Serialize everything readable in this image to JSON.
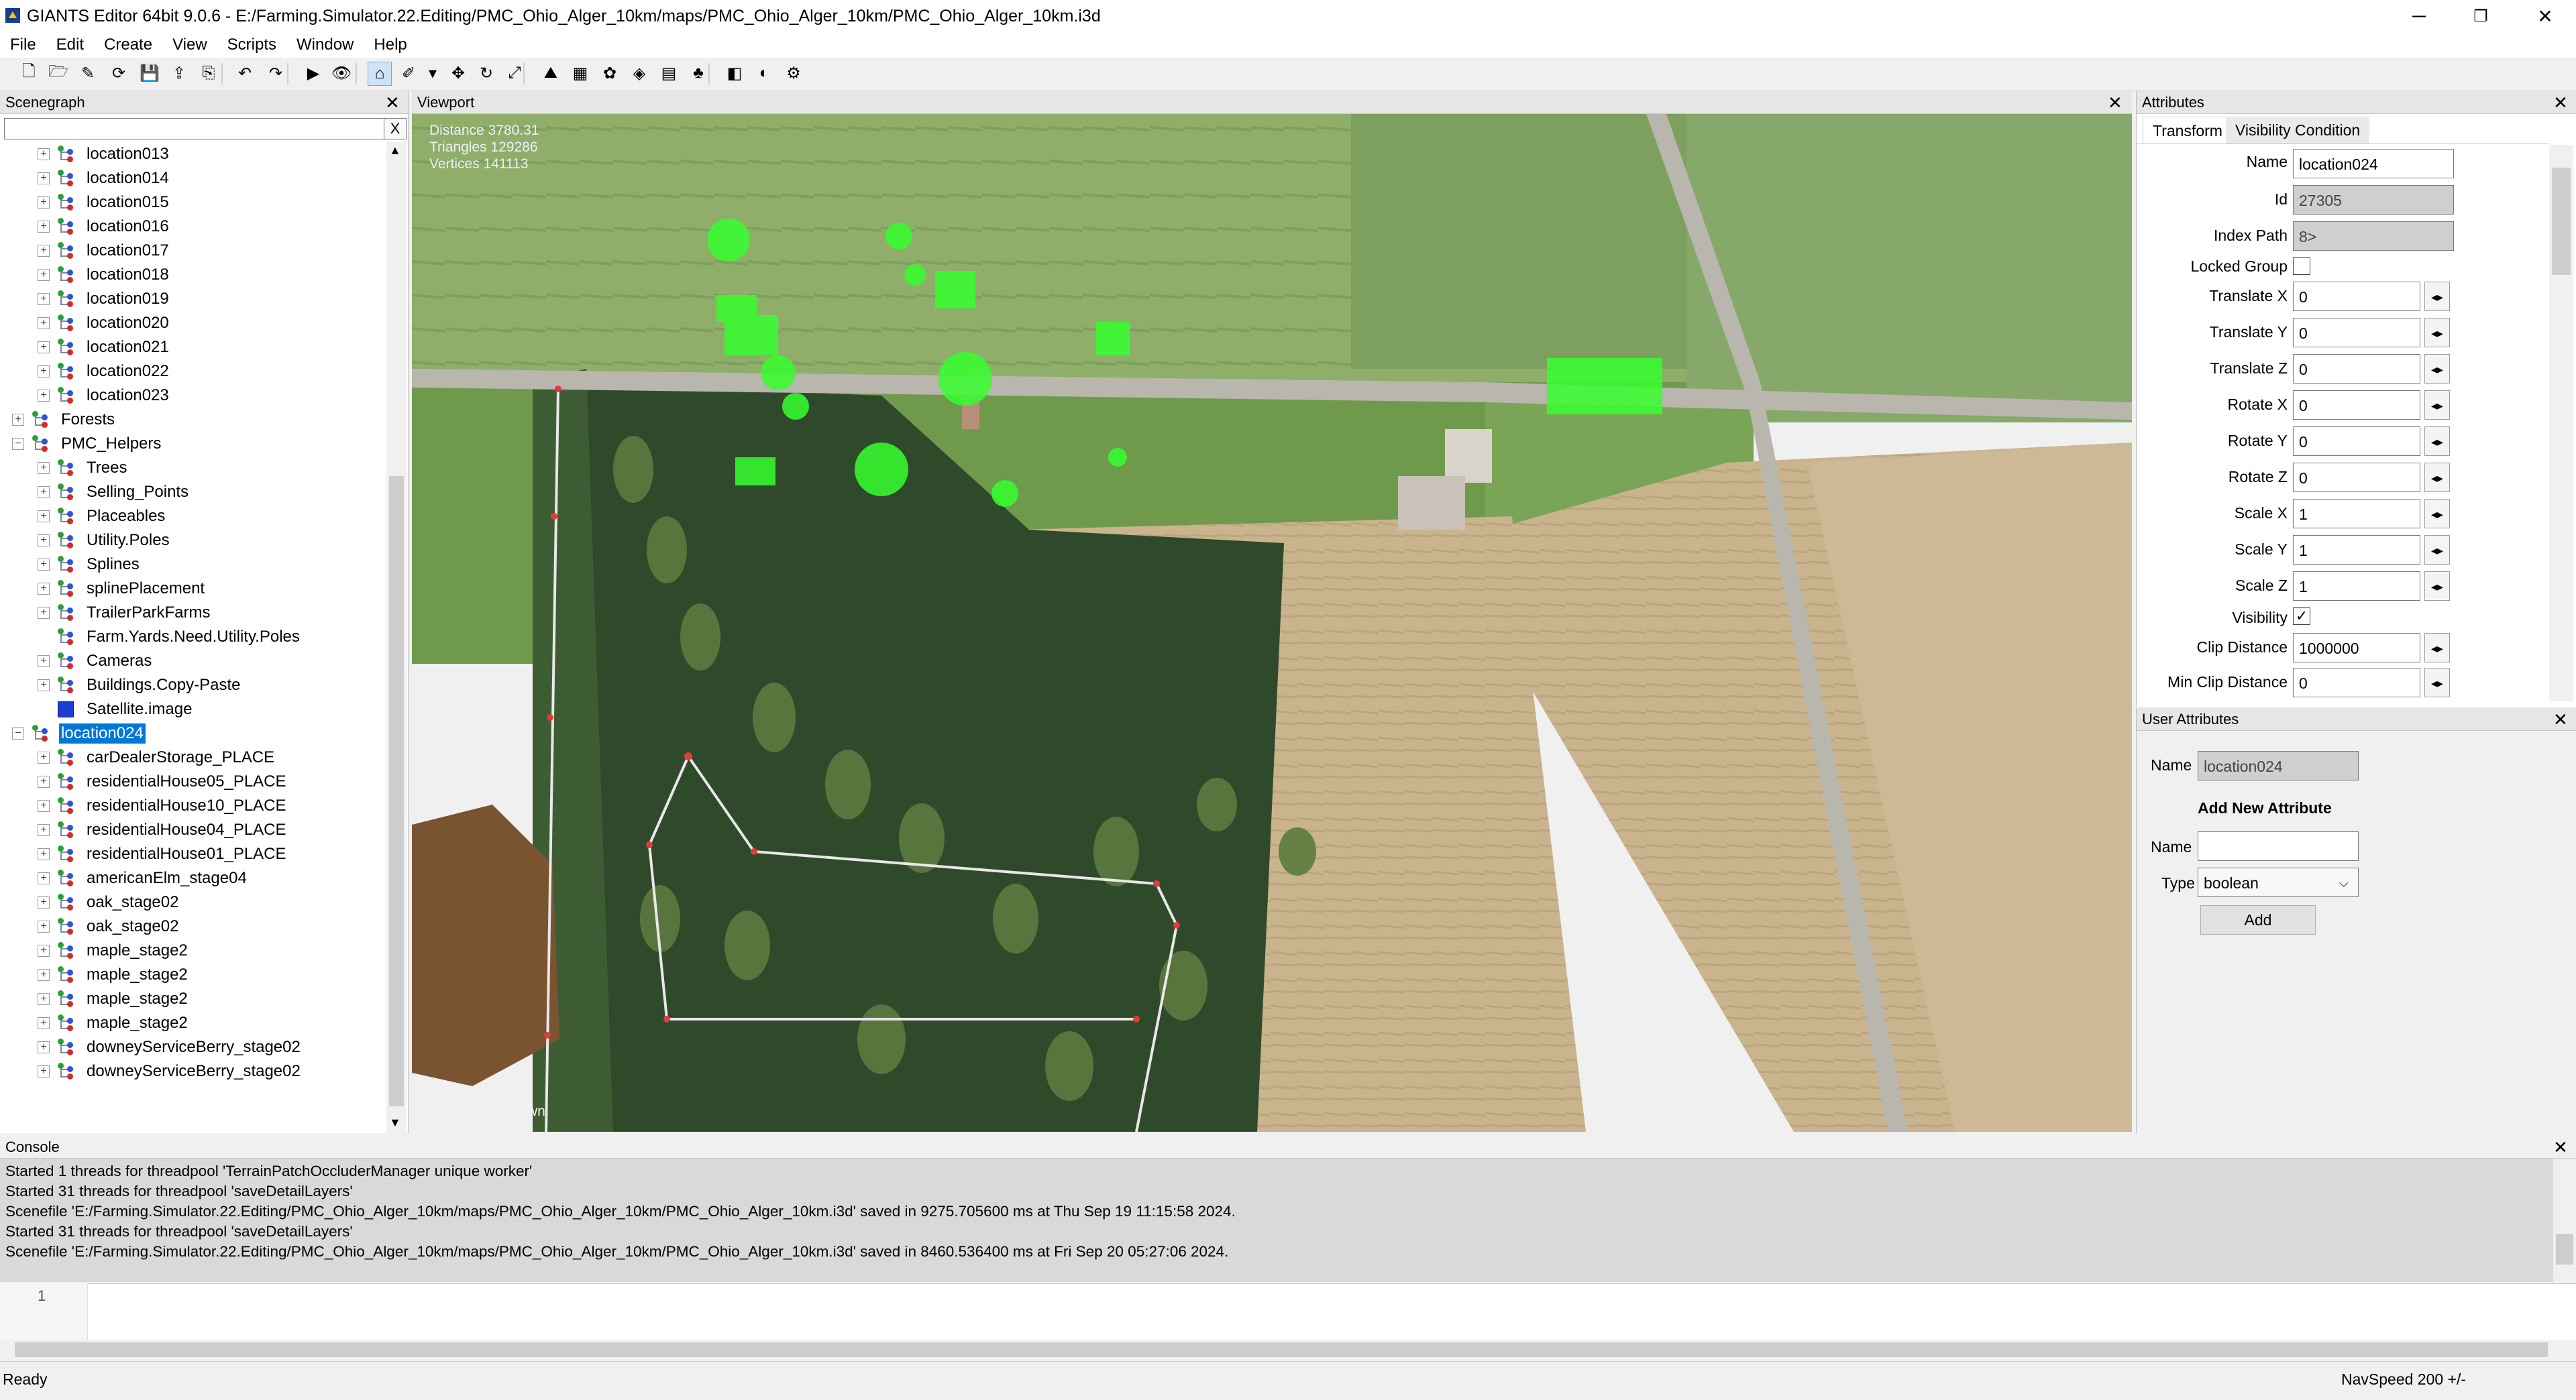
{
  "window": {
    "title": "GIANTS Editor 64bit 9.0.6 - E:/Farming.Simulator.22.Editing/PMC_Ohio_Alger_10km/maps/PMC_Ohio_Alger_10km/PMC_Ohio_Alger_10km.i3d",
    "minimize": "─",
    "restore": "❐",
    "close": "✕"
  },
  "menu": [
    "File",
    "Edit",
    "Create",
    "View",
    "Scripts",
    "Window",
    "Help"
  ],
  "toolbar_icons": [
    "new-file-icon",
    "open-folder-icon",
    "save-as-icon",
    "reload-icon",
    "save-icon",
    "export-icon",
    "import-icon",
    "undo-icon",
    "redo-icon",
    "play-icon",
    "eye-icon",
    "select-tool-icon",
    "paint-tool-icon",
    "dropdown-arrow-icon",
    "move-icon",
    "rotate-icon",
    "scale-icon",
    "terrain-sculpt-icon",
    "terrain-paint-icon",
    "foliage-paint-icon",
    "placement-paint-icon",
    "info-layer-icon",
    "tree-paint-icon",
    "render-icon",
    "shader-icon",
    "settings-gear-icon"
  ],
  "scenegraph": {
    "title": "Scenegraph",
    "close": "✕",
    "search_placeholder": "",
    "clear": "X",
    "nodes": [
      {
        "label": "location013",
        "depth": 1,
        "type": "transform",
        "exp": "+"
      },
      {
        "label": "location014",
        "depth": 1,
        "type": "transform",
        "exp": "+"
      },
      {
        "label": "location015",
        "depth": 1,
        "type": "transform",
        "exp": "+"
      },
      {
        "label": "location016",
        "depth": 1,
        "type": "transform",
        "exp": "+"
      },
      {
        "label": "location017",
        "depth": 1,
        "type": "transform",
        "exp": "+"
      },
      {
        "label": "location018",
        "depth": 1,
        "type": "transform",
        "exp": "+"
      },
      {
        "label": "location019",
        "depth": 1,
        "type": "transform",
        "exp": "+"
      },
      {
        "label": "location020",
        "depth": 1,
        "type": "transform",
        "exp": "+"
      },
      {
        "label": "location021",
        "depth": 1,
        "type": "transform",
        "exp": "+"
      },
      {
        "label": "location022",
        "depth": 1,
        "type": "transform",
        "exp": "+"
      },
      {
        "label": "location023",
        "depth": 1,
        "type": "transform",
        "exp": "+"
      },
      {
        "label": "Forests",
        "depth": 0,
        "type": "transform",
        "exp": "+"
      },
      {
        "label": "PMC_Helpers",
        "depth": 0,
        "type": "transform",
        "exp": "−"
      },
      {
        "label": "Trees",
        "depth": 1,
        "type": "transform",
        "exp": "+"
      },
      {
        "label": "Selling_Points",
        "depth": 1,
        "type": "transform",
        "exp": "+"
      },
      {
        "label": "Placeables",
        "depth": 1,
        "type": "transform",
        "exp": "+"
      },
      {
        "label": "Utility.Poles",
        "depth": 1,
        "type": "transform",
        "exp": "+"
      },
      {
        "label": "Splines",
        "depth": 1,
        "type": "transform",
        "exp": "+"
      },
      {
        "label": "splinePlacement",
        "depth": 1,
        "type": "transform",
        "exp": "+"
      },
      {
        "label": "TrailerParkFarms",
        "depth": 1,
        "type": "transform",
        "exp": "+"
      },
      {
        "label": "Farm.Yards.Need.Utility.Poles",
        "depth": 1,
        "type": "transform",
        "exp": ""
      },
      {
        "label": "Cameras",
        "depth": 1,
        "type": "transform",
        "exp": "+"
      },
      {
        "label": "Buildings.Copy-Paste",
        "depth": 1,
        "type": "transform",
        "exp": "+"
      },
      {
        "label": "Satellite.image",
        "depth": 1,
        "type": "shape",
        "exp": ""
      },
      {
        "label": "location024",
        "depth": 0,
        "type": "transform",
        "exp": "−",
        "selected": true
      },
      {
        "label": "carDealerStorage_PLACE",
        "depth": 1,
        "type": "transform",
        "exp": "+"
      },
      {
        "label": "residentialHouse05_PLACE",
        "depth": 1,
        "type": "transform",
        "exp": "+"
      },
      {
        "label": "residentialHouse10_PLACE",
        "depth": 1,
        "type": "transform",
        "exp": "+"
      },
      {
        "label": "residentialHouse04_PLACE",
        "depth": 1,
        "type": "transform",
        "exp": "+"
      },
      {
        "label": "residentialHouse01_PLACE",
        "depth": 1,
        "type": "transform",
        "exp": "+"
      },
      {
        "label": "americanElm_stage04",
        "depth": 1,
        "type": "transform",
        "exp": "+"
      },
      {
        "label": "oak_stage02",
        "depth": 1,
        "type": "transform",
        "exp": "+"
      },
      {
        "label": "oak_stage02",
        "depth": 1,
        "type": "transform",
        "exp": "+"
      },
      {
        "label": "maple_stage2",
        "depth": 1,
        "type": "transform",
        "exp": "+"
      },
      {
        "label": "maple_stage2",
        "depth": 1,
        "type": "transform",
        "exp": "+"
      },
      {
        "label": "maple_stage2",
        "depth": 1,
        "type": "transform",
        "exp": "+"
      },
      {
        "label": "maple_stage2",
        "depth": 1,
        "type": "transform",
        "exp": "+"
      },
      {
        "label": "downeyServiceBerry_stage02",
        "depth": 1,
        "type": "transform",
        "exp": "+"
      },
      {
        "label": "downeyServiceBerry_stage02",
        "depth": 1,
        "type": "transform",
        "exp": "+"
      }
    ]
  },
  "viewport": {
    "title": "Viewport",
    "close": "✕",
    "stats": [
      "Distance 3780.31",
      "Triangles 129286",
      "Vertices 141113"
    ],
    "camera": "camera_top_down"
  },
  "attributes": {
    "title": "Attributes",
    "close": "✕",
    "tabs": [
      "Transform",
      "Visibility Condition"
    ],
    "active_tab": "Transform",
    "name_label": "Name",
    "name_value": "location024",
    "id_label": "Id",
    "id_value": "27305",
    "index_path_label": "Index Path",
    "index_path_value": "8>",
    "locked_group_label": "Locked Group",
    "locked_group": false,
    "fields": [
      {
        "label": "Translate X",
        "value": "0"
      },
      {
        "label": "Translate Y",
        "value": "0"
      },
      {
        "label": "Translate Z",
        "value": "0"
      },
      {
        "label": "Rotate X",
        "value": "0"
      },
      {
        "label": "Rotate Y",
        "value": "0"
      },
      {
        "label": "Rotate Z",
        "value": "0"
      },
      {
        "label": "Scale X",
        "value": "1"
      },
      {
        "label": "Scale Y",
        "value": "1"
      },
      {
        "label": "Scale Z",
        "value": "1"
      }
    ],
    "visibility_label": "Visibility",
    "visibility_check": "✓",
    "clip_distance_label": "Clip Distance",
    "clip_distance_value": "1000000",
    "min_clip_distance_label": "Min Clip Distance",
    "min_clip_distance_value": "0",
    "spin_glyph": "◂▸"
  },
  "user_attributes": {
    "title": "User Attributes",
    "close": "✕",
    "name_label": "Name",
    "name_value": "location024",
    "add_heading": "Add New Attribute",
    "new_name_label": "Name",
    "new_name_value": "",
    "type_label": "Type",
    "type_value": "boolean",
    "add_button": "Add"
  },
  "console": {
    "title": "Console",
    "close": "✕",
    "lines": [
      "Started 1 threads for threadpool 'TerrainPatchOccluderManager unique worker'",
      "Started 31 threads for threadpool 'saveDetailLayers'",
      "Scenefile 'E:/Farming.Simulator.22.Editing/PMC_Ohio_Alger_10km/maps/PMC_Ohio_Alger_10km/PMC_Ohio_Alger_10km.i3d' saved in 9275.705600 ms at Thu Sep 19 11:15:58 2024.",
      "Started 31 threads for threadpool 'saveDetailLayers'",
      "Scenefile 'E:/Farming.Simulator.22.Editing/PMC_Ohio_Alger_10km/maps/PMC_Ohio_Alger_10km/PMC_Ohio_Alger_10km.i3d' saved in 8460.536400 ms at Fri Sep 20 05:27:06 2024."
    ]
  },
  "editor": {
    "line_number": "1"
  },
  "status": {
    "text": "Ready",
    "navspeed": "NavSpeed 200 +/-"
  },
  "colors": {
    "selection": "#0078d7",
    "node_dot_red": "#d42a2a",
    "node_dot_green": "#2f9e3a",
    "node_dot_blue": "#2a55d4",
    "grass": "#5f8a44",
    "field_tan": "#c9b48e",
    "road": "#b9b6ae",
    "placed_green": "#36ff2e"
  }
}
